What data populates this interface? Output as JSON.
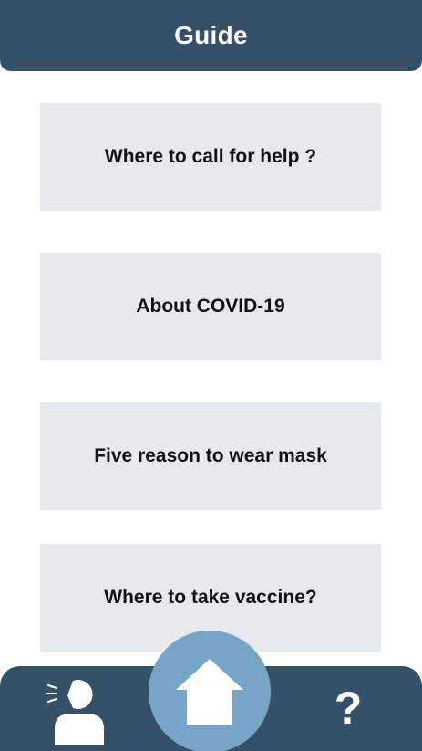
{
  "header": {
    "title": "Guide"
  },
  "cards": [
    {
      "label": "Where to call for help ?"
    },
    {
      "label": "About COVID-19"
    },
    {
      "label": "Five reason to wear mask"
    },
    {
      "label": "Where to take vaccine?"
    }
  ],
  "bottom_nav": {
    "left_icon": "speaking-person-icon",
    "center_icon": "home-icon",
    "right_icon": "question-mark-icon",
    "right_glyph": "?"
  },
  "colors": {
    "header_bg": "#355168",
    "card_bg": "#e7eaed",
    "home_button_bg": "#77a5c8",
    "text_dark": "#111111",
    "text_light": "#ffffff"
  }
}
